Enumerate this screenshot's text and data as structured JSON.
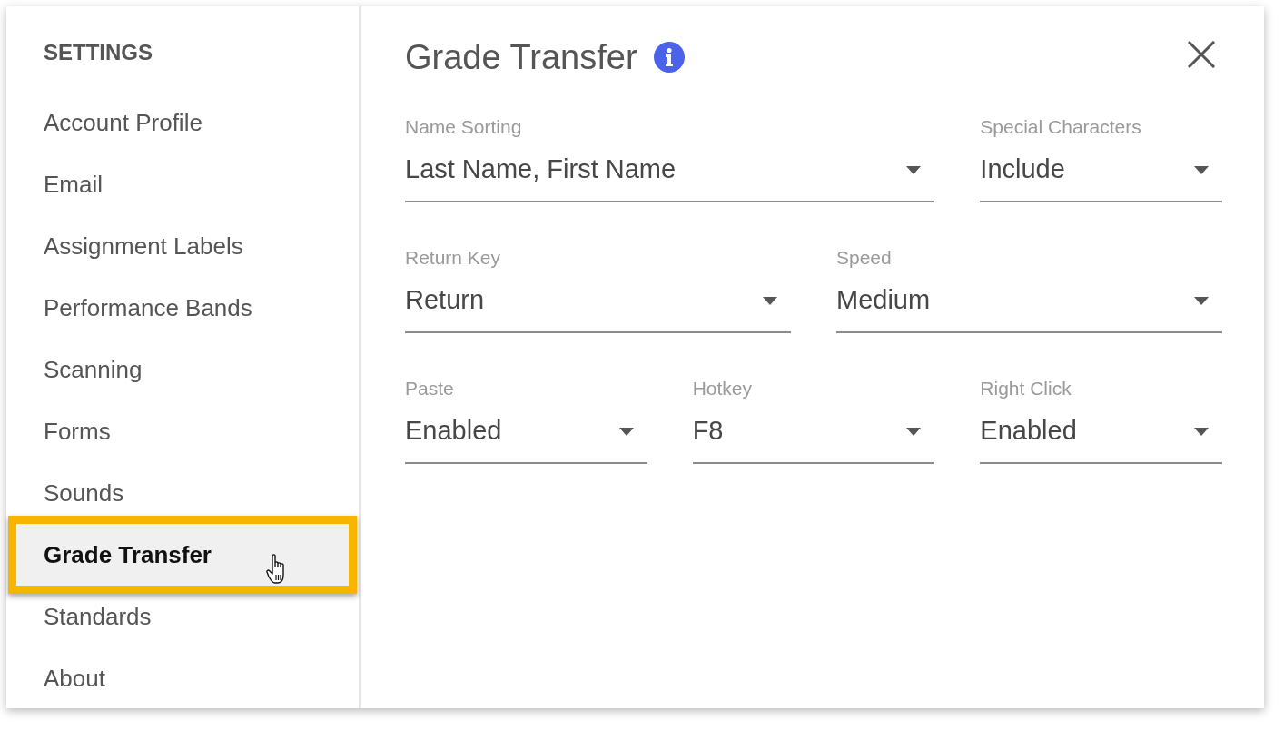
{
  "sidebar": {
    "heading": "SETTINGS",
    "items": [
      {
        "label": "Account Profile",
        "selected": false
      },
      {
        "label": "Email",
        "selected": false
      },
      {
        "label": "Assignment Labels",
        "selected": false
      },
      {
        "label": "Performance Bands",
        "selected": false
      },
      {
        "label": "Scanning",
        "selected": false
      },
      {
        "label": "Forms",
        "selected": false
      },
      {
        "label": "Sounds",
        "selected": false
      },
      {
        "label": "Grade Transfer",
        "selected": true
      },
      {
        "label": "Standards",
        "selected": false
      },
      {
        "label": "About",
        "selected": false
      }
    ]
  },
  "panel": {
    "title": "Grade Transfer",
    "field_rows": [
      [
        {
          "label": "Name Sorting",
          "value": "Last Name, First Name"
        },
        {
          "label": "Special Characters",
          "value": "Include"
        }
      ],
      [
        {
          "label": "Return Key",
          "value": "Return"
        },
        {
          "label": "Speed",
          "value": "Medium"
        }
      ],
      [
        {
          "label": "Paste",
          "value": "Enabled"
        },
        {
          "label": "Hotkey",
          "value": "F8"
        },
        {
          "label": "Right Click",
          "value": "Enabled"
        }
      ]
    ]
  }
}
